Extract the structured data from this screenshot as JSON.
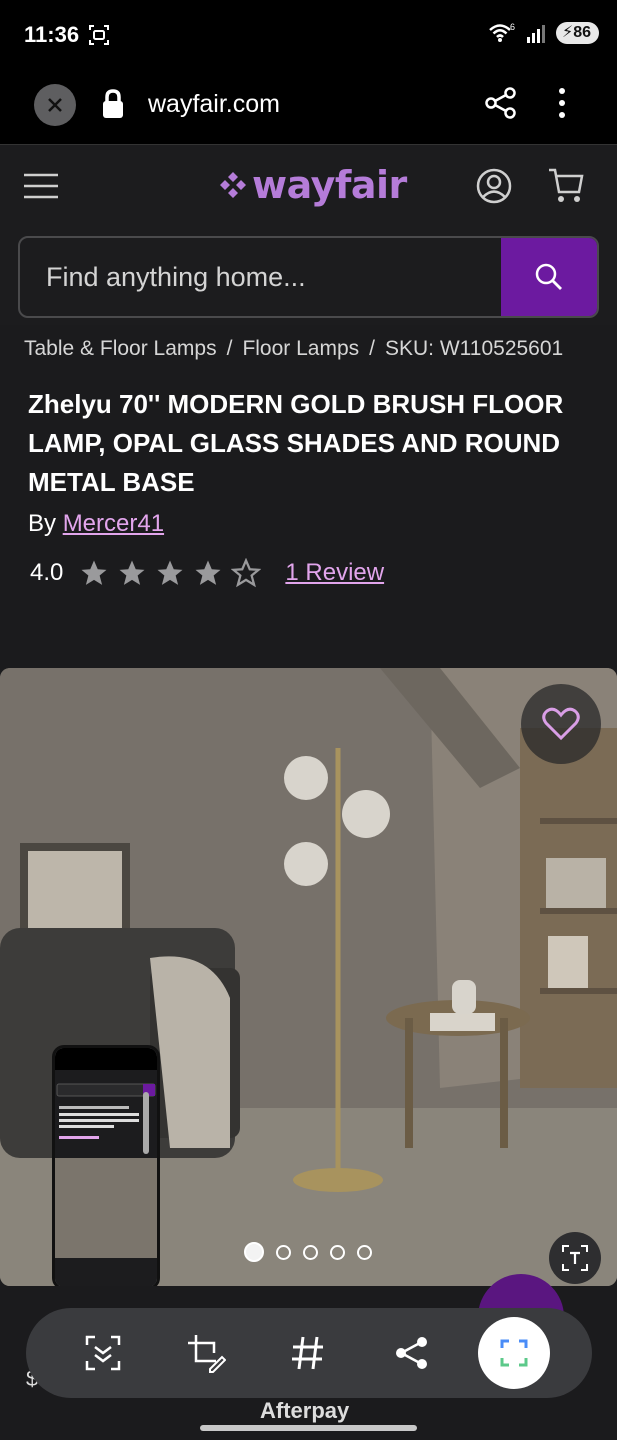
{
  "status_bar": {
    "time": "11:36",
    "battery": "86",
    "wifi_badge": "6"
  },
  "browser": {
    "url": "wayfair.com"
  },
  "header": {
    "logo": "wayfair",
    "search_placeholder": "Find anything home..."
  },
  "breadcrumb": {
    "items": [
      "Table & Floor Lamps",
      "Floor Lamps",
      "SKU: W110525601"
    ],
    "separator": "/"
  },
  "product": {
    "title": "Zhelyu 70'' MODERN GOLD BRUSH FLOOR LAMP, OPAL GLASS SHADES AND ROUND METAL BASE",
    "by_label": "By",
    "brand": "Mercer41",
    "rating": "4.0",
    "rating_value": 4,
    "rating_max": 5,
    "review_link": "1 Review"
  },
  "gallery": {
    "total_images": 5,
    "active_index": 0
  },
  "bottom": {
    "price_partial": "$3",
    "afterpay_partial": "Afterpay"
  },
  "colors": {
    "brand_purple": "#6c1aa0",
    "link_pink": "#e2a5ec",
    "logo_purple": "#b57cd9"
  }
}
